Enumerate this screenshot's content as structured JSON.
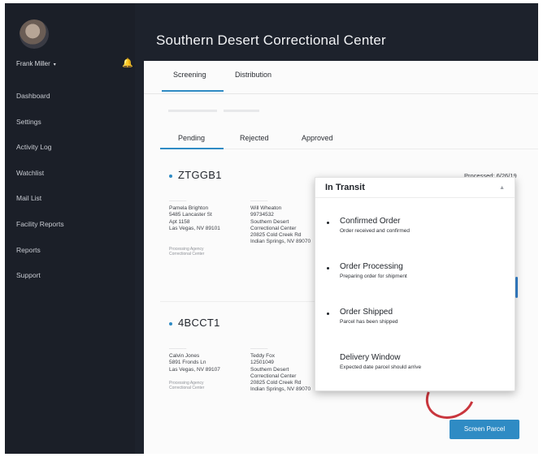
{
  "user": {
    "name": "Frank Miller",
    "caret": "▾"
  },
  "header": {
    "title": "Southern Desert Correctional Center"
  },
  "sidebar": {
    "items": [
      {
        "label": "Dashboard"
      },
      {
        "label": "Settings"
      },
      {
        "label": "Activity Log"
      },
      {
        "label": "Watchlist"
      },
      {
        "label": "Mail List"
      },
      {
        "label": "Facility Reports"
      },
      {
        "label": "Reports"
      },
      {
        "label": "Support"
      }
    ]
  },
  "tabs": {
    "screening": "Screening",
    "distribution": "Distribution"
  },
  "subtabs": {
    "pending": "Pending",
    "rejected": "Rejected",
    "approved": "Approved"
  },
  "parcels": [
    {
      "id": "ZTGGB1",
      "processed": "Processed: 6/26/19",
      "sender": "Pamela Brighton\n5485 Lancaster St\nApt 1158\nLas Vegas, NV 89101",
      "note": "Processing Agency\nCorrectional Center",
      "recipient": "Will Wheaton\n99734532\nSouthern Desert\nCorrectional Center\n20825 Cold Creek Rd\nIndian Springs, NV 89070"
    },
    {
      "id": "4BCCT1",
      "sender": "Calvin Jones\n5891 Fronds Ln\nLas Vegas, NV 89107",
      "note": "Processing Agency\nCorrectional Center",
      "recipient": "Teddy Fox\n12501049\nSouthern Desert\nCorrectional Center\n20825 Cold Creek Rd\nIndian Springs, NV 89070"
    }
  ],
  "tracking": {
    "title": "In Transit",
    "steps": [
      {
        "title": "Confirmed Order",
        "desc": "Order received and confirmed"
      },
      {
        "title": "Order Processing",
        "desc": "Preparing order for shipment"
      },
      {
        "title": "Order Shipped",
        "desc": "Parcel has been shipped"
      },
      {
        "title": "Delivery Window",
        "desc": "Expected date parcel should arrive"
      }
    ]
  },
  "actions": {
    "screen_parcel": "Screen Parcel"
  },
  "colors": {
    "accent": "#2f8bc4",
    "sidebar_bg": "#1b1f28",
    "alert_red": "#c9363d"
  },
  "icons": {
    "bell": "bell-icon",
    "avatar": "user-avatar"
  }
}
